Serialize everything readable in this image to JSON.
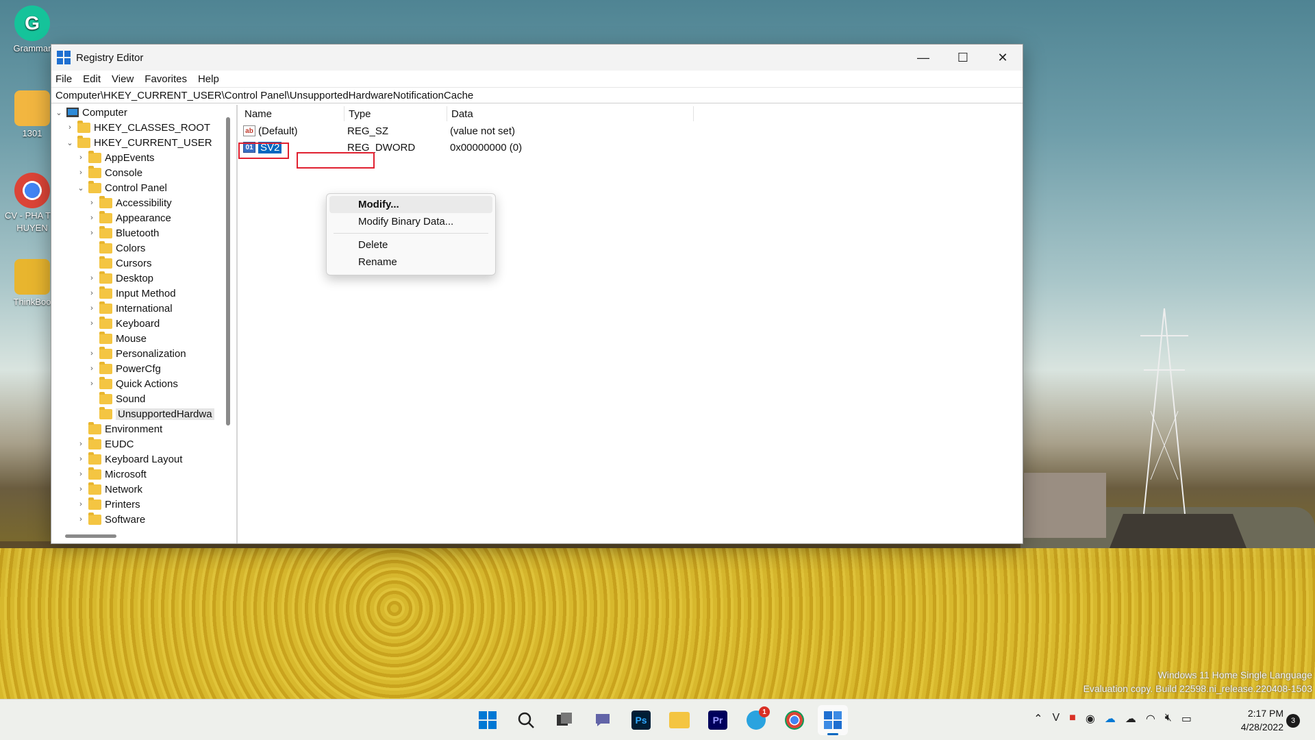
{
  "desktop": {
    "icons": [
      {
        "label": "Grammar"
      },
      {
        "label": "1301"
      },
      {
        "label": "CV - PHA THI HUYEN"
      },
      {
        "label": "ThinkBoo"
      }
    ],
    "watermark": {
      "line1": "Windows 11 Home Single Language",
      "line2": "Evaluation copy. Build 22598.ni_release.220408-1503"
    }
  },
  "window": {
    "title": "Registry Editor",
    "controls": {
      "minimize": "—",
      "maximize": "☐",
      "close": "✕"
    },
    "menu": [
      "File",
      "Edit",
      "View",
      "Favorites",
      "Help"
    ],
    "address": "Computer\\HKEY_CURRENT_USER\\Control Panel\\UnsupportedHardwareNotificationCache"
  },
  "tree": {
    "root": "Computer",
    "hkcr": "HKEY_CLASSES_ROOT",
    "hkcu": "HKEY_CURRENT_USER",
    "hkcu_children": [
      "AppEvents",
      "Console",
      "Control Panel"
    ],
    "control_panel_children": [
      "Accessibility",
      "Appearance",
      "Bluetooth",
      "Colors",
      "Cursors",
      "Desktop",
      "Input Method",
      "International",
      "Keyboard",
      "Mouse",
      "Personalization",
      "PowerCfg",
      "Quick Actions",
      "Sound",
      "UnsupportedHardwa"
    ],
    "hkcu_after": [
      "Environment",
      "EUDC",
      "Keyboard Layout",
      "Microsoft",
      "Network",
      "Printers",
      "Software"
    ]
  },
  "list": {
    "headers": {
      "name": "Name",
      "type": "Type",
      "data": "Data"
    },
    "rows": [
      {
        "icon": "string-value-icon",
        "name": "(Default)",
        "type": "REG_SZ",
        "data": "(value not set)"
      },
      {
        "icon": "dword-value-icon",
        "name": "SV2",
        "type": "REG_DWORD",
        "data": "0x00000000 (0)"
      }
    ]
  },
  "context_menu": {
    "modify": "Modify...",
    "modify_binary": "Modify Binary Data...",
    "delete": "Delete",
    "rename": "Rename"
  },
  "taskbar": {
    "apps": [
      "windows-start-icon",
      "search-icon",
      "task-view-icon",
      "chat-icon",
      "photoshop-icon",
      "file-explorer-icon",
      "premiere-icon",
      "telegram-icon",
      "chrome-icon",
      "registry-editor-icon"
    ],
    "telegram_badge": "1",
    "clock_time": "2:17 PM",
    "clock_date": "4/28/2022",
    "notifications": "3"
  },
  "colors": {
    "accent": "#0067c0",
    "highlight_box": "#e0202f"
  }
}
